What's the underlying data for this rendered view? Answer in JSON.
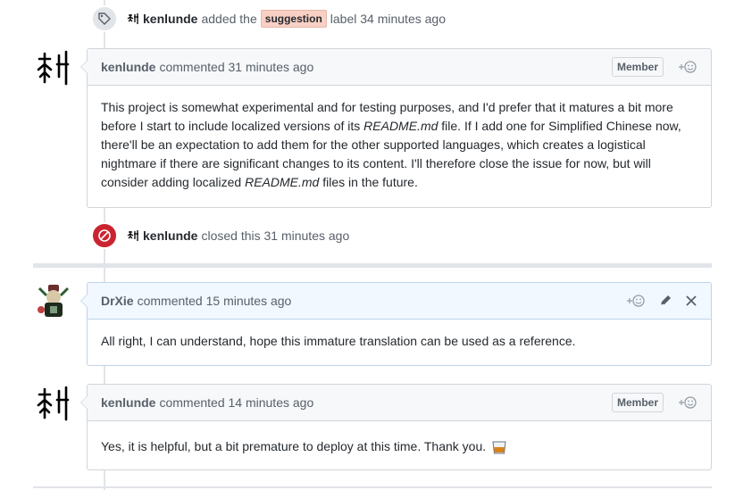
{
  "events": {
    "labeled": {
      "author": "kenlunde",
      "pre": "added the",
      "label": "suggestion",
      "post": "label 34 minutes ago"
    },
    "closed": {
      "author": "kenlunde",
      "text": "closed this 31 minutes ago"
    }
  },
  "comments": [
    {
      "author": "kenlunde",
      "meta": "commented 31 minutes ago",
      "role": "Member",
      "body_parts": [
        "This project is somewhat experimental and for testing purposes, and I'd prefer that it matures a bit more before I start to include localized versions of its ",
        "README.md",
        " file. If I add one for Simplified Chinese now, there'll be an expectation to add them for the other supported languages, which creates a logistical nightmare if there are significant changes to its content. I'll therefore close the issue for now, but will consider adding localized ",
        "README.md",
        " files in the future."
      ]
    },
    {
      "author": "DrXie",
      "meta": "commented 15 minutes ago",
      "body": "All right, I can understand, hope this immature translation can be used as a reference."
    },
    {
      "author": "kenlunde",
      "meta": "commented 14 minutes ago",
      "role": "Member",
      "body": "Yes, it is helpful, but a bit premature to deploy at this time. Thank you."
    }
  ],
  "colors": {
    "closed_badge": "#cb2431",
    "label_bg": "#f9d0c4",
    "author_header_bg": "#f1f8ff"
  }
}
